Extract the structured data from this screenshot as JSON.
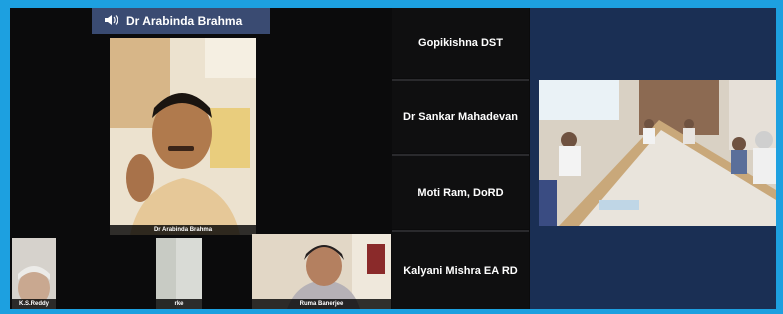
{
  "active_speaker": {
    "name": "Dr Arabinda Brahma",
    "icon": "speaker-icon"
  },
  "main_video": {
    "label": "Dr Arabinda Brahma"
  },
  "gallery_small": [
    {
      "label": "K.S.Reddy"
    },
    {
      "label": "rke"
    },
    {
      "label": "Ruma Banerjee"
    }
  ],
  "name_tiles": [
    {
      "name": "Gopikishna DST"
    },
    {
      "name": "Dr Sankar Mahadevan"
    },
    {
      "name": "Moti Ram, DoRD"
    },
    {
      "name": "Kalyani Mishra EA RD"
    }
  ],
  "colors": {
    "frame": "#1da0e0",
    "screen": "#0b0b0c",
    "speaker_bar": "#3a4b72",
    "panel": "#1a2f54"
  }
}
